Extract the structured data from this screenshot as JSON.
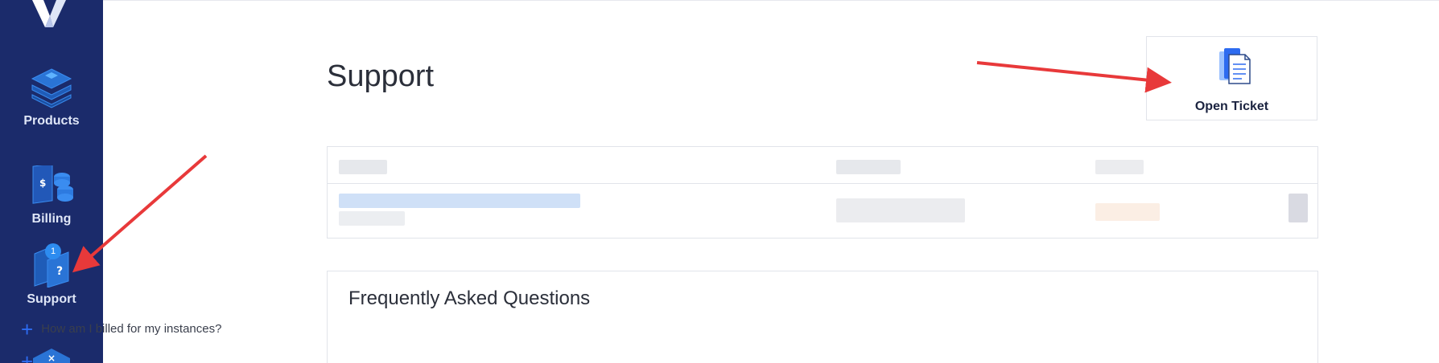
{
  "sidebar": {
    "items": [
      {
        "label": "Products",
        "icon": "layers-icon"
      },
      {
        "label": "Billing",
        "icon": "billing-coins-icon"
      },
      {
        "label": "Support",
        "icon": "support-question-icon",
        "badge": "1"
      }
    ]
  },
  "page": {
    "title": "Support"
  },
  "ticket_card": {
    "label": "Open Ticket",
    "icon": "ticket-document-icon"
  },
  "faq": {
    "title": "Frequently Asked Questions",
    "items": [
      "How am I billed for my instances?"
    ]
  },
  "colors": {
    "sidebar_bg": "#1b2b6b",
    "accent": "#2d6bf0",
    "arrow": "#e8393a"
  }
}
